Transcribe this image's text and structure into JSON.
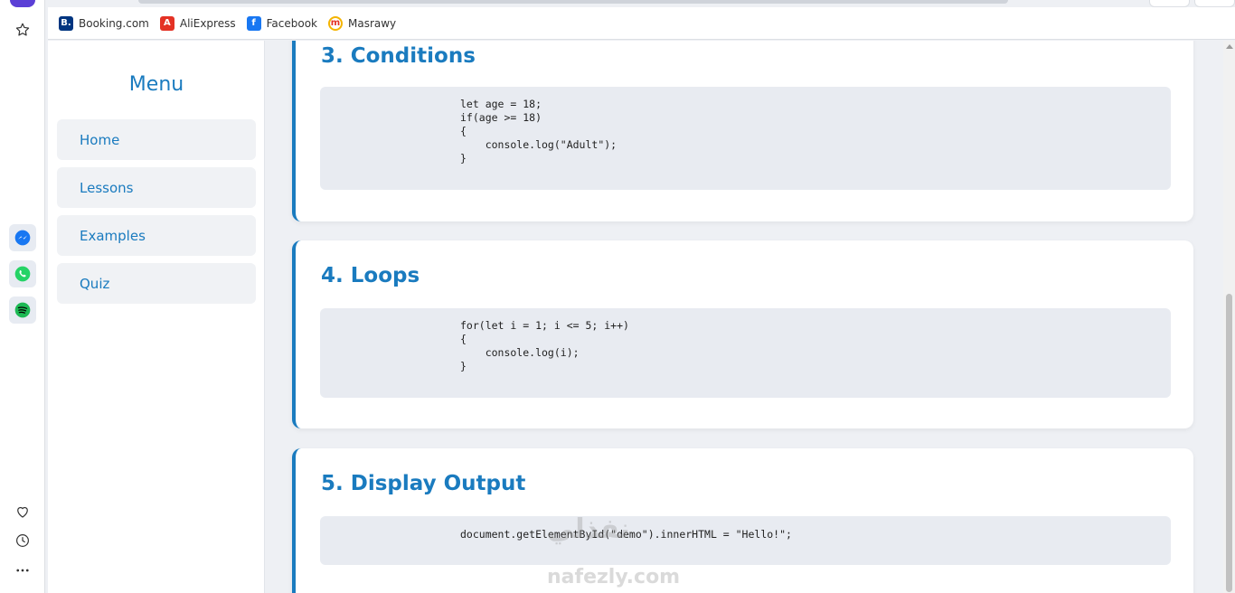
{
  "bookmarks": [
    {
      "label": "Booking.com",
      "icon": "booking-icon",
      "color": "#003580",
      "glyph": "B."
    },
    {
      "label": "AliExpress",
      "icon": "aliexpress-icon",
      "color": "#e43225",
      "glyph": "A"
    },
    {
      "label": "Facebook",
      "icon": "facebook-icon",
      "color": "#1877f2",
      "glyph": "f"
    },
    {
      "label": "Masrawy",
      "icon": "masrawy-icon",
      "color": "#f4b400",
      "glyph": "m"
    }
  ],
  "sidebar": {
    "title": "Menu",
    "items": [
      {
        "label": "Home"
      },
      {
        "label": "Lessons"
      },
      {
        "label": "Examples"
      },
      {
        "label": "Quiz"
      }
    ]
  },
  "lessons": [
    {
      "title": "3. Conditions",
      "code": "let age = 18;\nif(age >= 18)\n{\n    console.log(\"Adult\");\n}"
    },
    {
      "title": "4. Loops",
      "code": "for(let i = 1; i <= 5; i++)\n{\n    console.log(i);\n}"
    },
    {
      "title": "5. Display Output",
      "code": "document.getElementById(\"demo\").innerHTML = \"Hello!\";"
    }
  ],
  "watermark": {
    "arabic": "نفذلي",
    "latin": "nafezly.com"
  },
  "colors": {
    "accent": "#1a7bbf",
    "code_bg": "#e8ebf1"
  }
}
